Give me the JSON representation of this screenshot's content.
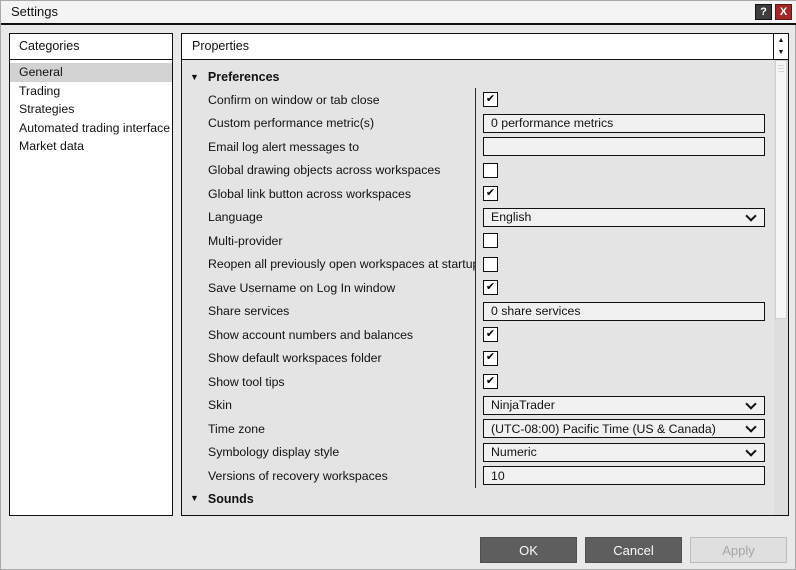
{
  "window": {
    "title": "Settings",
    "help_glyph": "?",
    "close_glyph": "X"
  },
  "icons": {
    "spinner_up": "▲",
    "spinner_down": "▼",
    "section_collapse": "▼",
    "checkmark": "✔"
  },
  "colors": {
    "close_button_red": "#a02828",
    "titlebar_border": "#111111",
    "selected_item_gray": "#d2d2d2",
    "field_background": "#f1f1f1",
    "button_dark_gray": "#5e5e5e",
    "panel_background": "#e4e4e4"
  },
  "categories": {
    "header": "Categories",
    "items": [
      {
        "label": "General",
        "selected": true
      },
      {
        "label": "Trading",
        "selected": false
      },
      {
        "label": "Strategies",
        "selected": false
      },
      {
        "label": "Automated trading interface",
        "selected": false
      },
      {
        "label": "Market data",
        "selected": false
      }
    ]
  },
  "properties": {
    "header": "Properties",
    "sections": [
      {
        "title": "Preferences",
        "expanded": true,
        "rows": [
          {
            "label": "Confirm on window or tab close",
            "type": "checkbox",
            "checked": true
          },
          {
            "label": "Custom performance metric(s)",
            "type": "text",
            "value": "0 performance metrics"
          },
          {
            "label": "Email log alert messages to",
            "type": "text",
            "value": ""
          },
          {
            "label": "Global drawing objects across workspaces",
            "type": "checkbox",
            "checked": false
          },
          {
            "label": "Global link button across workspaces",
            "type": "checkbox",
            "checked": true
          },
          {
            "label": "Language",
            "type": "select",
            "value": "English"
          },
          {
            "label": "Multi-provider",
            "type": "checkbox",
            "checked": false
          },
          {
            "label": "Reopen all previously open workspaces at startup",
            "type": "checkbox",
            "checked": false
          },
          {
            "label": "Save Username on Log In window",
            "type": "checkbox",
            "checked": true
          },
          {
            "label": "Share services",
            "type": "text",
            "value": "0 share services"
          },
          {
            "label": "Show account numbers and balances",
            "type": "checkbox",
            "checked": true
          },
          {
            "label": "Show default workspaces folder",
            "type": "checkbox",
            "checked": true
          },
          {
            "label": "Show tool tips",
            "type": "checkbox",
            "checked": true
          },
          {
            "label": "Skin",
            "type": "select",
            "value": "NinjaTrader"
          },
          {
            "label": "Time zone",
            "type": "select",
            "value": "(UTC-08:00) Pacific Time (US & Canada)"
          },
          {
            "label": "Symbology display style",
            "type": "select",
            "value": "Numeric"
          },
          {
            "label": "Versions of recovery workspaces",
            "type": "text",
            "value": "10"
          }
        ]
      },
      {
        "title": "Sounds",
        "expanded": true,
        "rows": []
      }
    ]
  },
  "footer": {
    "ok_label": "OK",
    "cancel_label": "Cancel",
    "apply_label": "Apply"
  }
}
